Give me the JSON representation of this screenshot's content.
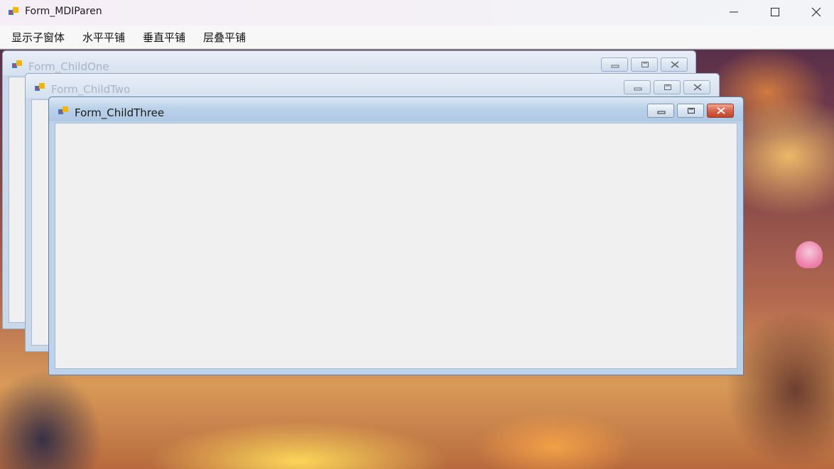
{
  "window": {
    "title": "Form_MDIParen",
    "app_icon": "winforms-app-icon"
  },
  "caption_buttons": [
    "minimize-icon",
    "maximize-icon",
    "close-icon"
  ],
  "menu": {
    "items": [
      {
        "label": "显示子窗体"
      },
      {
        "label": "水平平铺"
      },
      {
        "label": "垂直平铺"
      },
      {
        "label": "层叠平铺"
      }
    ]
  },
  "children": [
    {
      "title": "Form_ChildOne",
      "state": "inactive"
    },
    {
      "title": "Form_ChildTwo",
      "state": "inactive"
    },
    {
      "title": "Form_ChildThree",
      "state": "active"
    }
  ],
  "colors": {
    "active_caption": "#afc8e3",
    "inactive_caption": "#d5e1ee",
    "close_button_active": "#c2452c",
    "client_area": "#f0f0f0"
  }
}
